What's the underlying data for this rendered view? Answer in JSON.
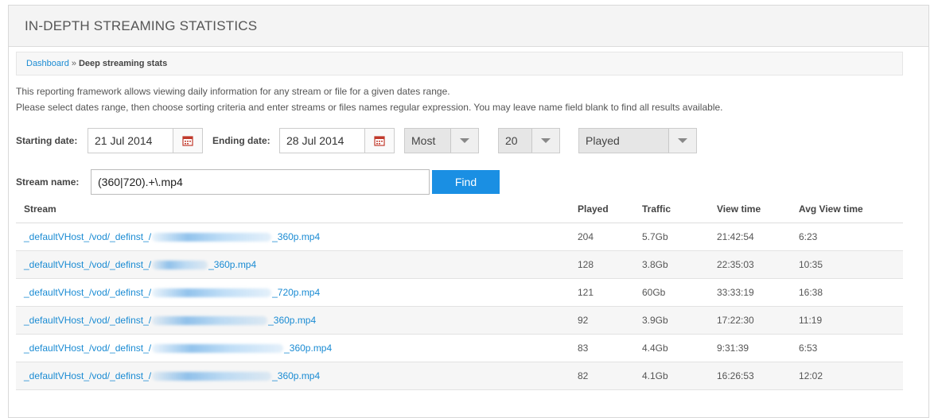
{
  "page": {
    "title": "IN-DEPTH STREAMING STATISTICS"
  },
  "breadcrumb": {
    "link": "Dashboard",
    "separator": "»",
    "current": "Deep streaming stats"
  },
  "description": {
    "line1": "This reporting framework allows viewing daily information for any stream or file for a given dates range.",
    "line2": "Please select dates range, then choose sorting criteria and enter streams or files names regular expression. You may leave name field blank to find all results available."
  },
  "filters": {
    "start_label": "Starting date:",
    "start_value": "21 Jul 2014",
    "end_label": "Ending date:",
    "end_value": "28 Jul 2014",
    "order_value": "Most",
    "limit_value": "20",
    "sort_value": "Played",
    "stream_label": "Stream name:",
    "stream_value": "(360|720).+\\.mp4",
    "find_label": "Find"
  },
  "table": {
    "headers": {
      "stream": "Stream",
      "played": "Played",
      "traffic": "Traffic",
      "view_time": "View time",
      "avg_view_time": "Avg View time"
    },
    "rows": [
      {
        "prefix": "_defaultVHost_/vod/_definst_/",
        "suffix": "_360p.mp4",
        "played": "204",
        "traffic": "5.7Gb",
        "view_time": "21:42:54",
        "avg_view_time": "6:23"
      },
      {
        "prefix": "_defaultVHost_/vod/_definst_/",
        "suffix": "_360p.mp4",
        "played": "128",
        "traffic": "3.8Gb",
        "view_time": "22:35:03",
        "avg_view_time": "10:35"
      },
      {
        "prefix": "_defaultVHost_/vod/_definst_/",
        "suffix": "_720p.mp4",
        "played": "121",
        "traffic": "60Gb",
        "view_time": "33:33:19",
        "avg_view_time": "16:38"
      },
      {
        "prefix": "_defaultVHost_/vod/_definst_/",
        "suffix": "_360p.mp4",
        "played": "92",
        "traffic": "3.9Gb",
        "view_time": "17:22:30",
        "avg_view_time": "11:19"
      },
      {
        "prefix": "_defaultVHost_/vod/_definst_/",
        "suffix": "_360p.mp4",
        "played": "83",
        "traffic": "4.4Gb",
        "view_time": "9:31:39",
        "avg_view_time": "6:53"
      },
      {
        "prefix": "_defaultVHost_/vod/_definst_/",
        "suffix": "_360p.mp4",
        "played": "82",
        "traffic": "4.1Gb",
        "view_time": "16:26:53",
        "avg_view_time": "12:02"
      }
    ]
  },
  "icons": {
    "calendar": "calendar-icon",
    "dropdown": "chevron-down-icon"
  },
  "colors": {
    "link": "#1a8bd3",
    "button": "#1a8fe3",
    "calendar": "#c0392b"
  }
}
